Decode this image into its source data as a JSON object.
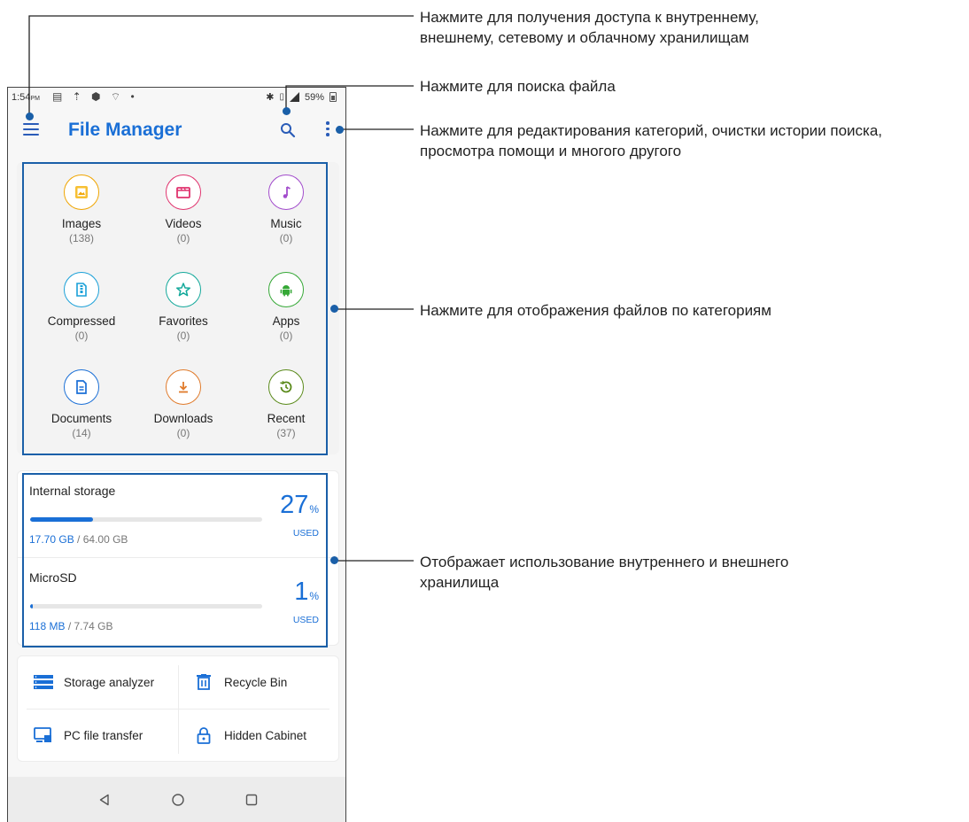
{
  "status_bar": {
    "time": "1:54",
    "ampm": "PM",
    "battery": "59%"
  },
  "app_bar": {
    "title": "File Manager",
    "icons": [
      "menu-icon",
      "search-icon",
      "more-vert-icon"
    ]
  },
  "categories": [
    {
      "label": "Images",
      "count": "(138)",
      "icon": "image-icon",
      "color": "#f0a500"
    },
    {
      "label": "Videos",
      "count": "(0)",
      "icon": "video-icon",
      "color": "#e0336e"
    },
    {
      "label": "Music",
      "count": "(0)",
      "icon": "music-icon",
      "color": "#a24ccc"
    },
    {
      "label": "Compressed",
      "count": "(0)",
      "icon": "archive-icon",
      "color": "#1aa0d8"
    },
    {
      "label": "Favorites",
      "count": "(0)",
      "icon": "star-icon",
      "color": "#12a89a"
    },
    {
      "label": "Apps",
      "count": "(0)",
      "icon": "android-icon",
      "color": "#35a836"
    },
    {
      "label": "Documents",
      "count": "(14)",
      "icon": "document-icon",
      "color": "#1a6fd6"
    },
    {
      "label": "Downloads",
      "count": "(0)",
      "icon": "download-icon",
      "color": "#e07a2a"
    },
    {
      "label": "Recent",
      "count": "(37)",
      "icon": "history-icon",
      "color": "#5a8a1a"
    }
  ],
  "storage": [
    {
      "name": "Internal storage",
      "percent": "27",
      "percent_unit": "%",
      "used_label": "USED",
      "used": "17.70 GB",
      "total": "/ 64.00 GB",
      "fill": 0.27
    },
    {
      "name": "MicroSD",
      "percent": "1",
      "percent_unit": "%",
      "used_label": "USED",
      "used": "118 MB",
      "total": "/ 7.74 GB",
      "fill": 0.01
    }
  ],
  "tools": [
    {
      "label": "Storage analyzer",
      "icon": "storage-analyzer-icon"
    },
    {
      "label": "Recycle Bin",
      "icon": "trash-icon"
    },
    {
      "label": "PC file transfer",
      "icon": "pc-transfer-icon"
    },
    {
      "label": "Hidden Cabinet",
      "icon": "lock-icon"
    }
  ],
  "nav": [
    "back-icon",
    "home-icon",
    "recents-icon"
  ],
  "callouts": {
    "menu_line1": "Нажмите для получения доступа к внутреннему,",
    "menu_line2": "внешнему, сетевому и облачному хранилищам",
    "search": "Нажмите для поиска файла",
    "more_line1": "Нажмите для редактирования категорий, очистки истории поиска,",
    "more_line2": "просмотра помощи и многого другого",
    "categories": "Нажмите для отображения файлов по категориям",
    "storage_line1": "Отображает использование внутреннего и внешнего",
    "storage_line2": "хранилища"
  },
  "colors": {
    "accent": "#1a6fd6",
    "callout": "#1a5fa8"
  }
}
